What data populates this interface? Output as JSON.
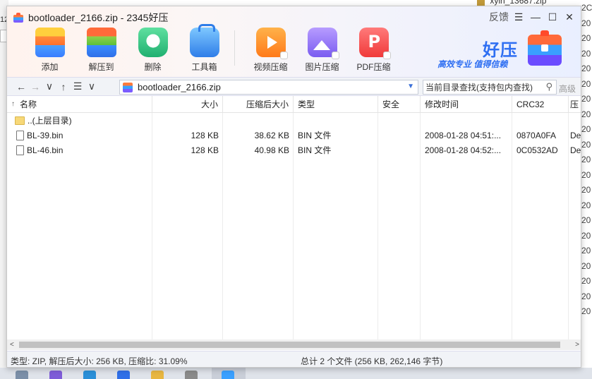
{
  "window": {
    "title": "bootloader_2166.zip - 2345好压",
    "feedback": "反馈",
    "menu_glyph": "☰",
    "minimize_glyph": "—",
    "maximize_glyph": "☐",
    "close_glyph": "✕"
  },
  "toolbar": {
    "items": [
      {
        "label": "添加",
        "icon": "add-archive-icon"
      },
      {
        "label": "解压到",
        "icon": "extract-to-icon"
      },
      {
        "label": "删除",
        "icon": "recycle-delete-icon"
      },
      {
        "label": "工具箱",
        "icon": "toolbox-icon"
      },
      {
        "label": "视频压缩",
        "icon": "video-compress-icon"
      },
      {
        "label": "图片压缩",
        "icon": "image-compress-icon"
      },
      {
        "label": "PDF压缩",
        "icon": "pdf-compress-icon"
      }
    ]
  },
  "brand": {
    "name": "好压",
    "slogan": "高效专业  值得信赖"
  },
  "address": {
    "back": "←",
    "forward": "→",
    "history": "∨",
    "up": "↑",
    "view": "☰",
    "view_dd": "∨",
    "path": "bootloader_2166.zip",
    "dropdown": "▼",
    "search_placeholder": "当前目录查找(支持包内查找)",
    "search_icon": "⚲",
    "advanced": "高级"
  },
  "columns": {
    "name": "名称",
    "sort_arrow": "↑",
    "size": "大小",
    "packed": "压缩后大小",
    "type": "类型",
    "security": "安全",
    "modified": "修改时间",
    "crc": "CRC32",
    "method": "压"
  },
  "rows": [
    {
      "name": "..(上层目录)",
      "kind": "folder",
      "size": "",
      "packed": "",
      "type": "",
      "security": "",
      "modified": "",
      "crc": "",
      "method": ""
    },
    {
      "name": "BL-39.bin",
      "kind": "file",
      "size": "128 KB",
      "packed": "38.62 KB",
      "type": "BIN 文件",
      "security": "",
      "modified": "2008-01-28 04:51:...",
      "crc": "0870A0FA",
      "method": "De"
    },
    {
      "name": "BL-46.bin",
      "kind": "file",
      "size": "128 KB",
      "packed": "40.98 KB",
      "type": "BIN 文件",
      "security": "",
      "modified": "2008-01-28 04:52:...",
      "crc": "0C0532AD",
      "method": "De"
    }
  ],
  "scroll": {
    "left": "<",
    "right": ">"
  },
  "status": {
    "left": "类型: ZIP, 解压后大小: 256 KB, 压缩比: 31.09%",
    "right": "总计 2 个文件 (256 KB, 262,146 字节)"
  },
  "background": {
    "left_text": "12",
    "top_file": "xylh_13687.zip",
    "right_years": [
      "2C",
      "20",
      "20",
      "20",
      "20",
      "20",
      "20",
      "20",
      "20",
      "20",
      "20",
      "20",
      "20",
      "20",
      "20",
      "20",
      "20",
      "20",
      "20",
      "20",
      "20"
    ]
  }
}
